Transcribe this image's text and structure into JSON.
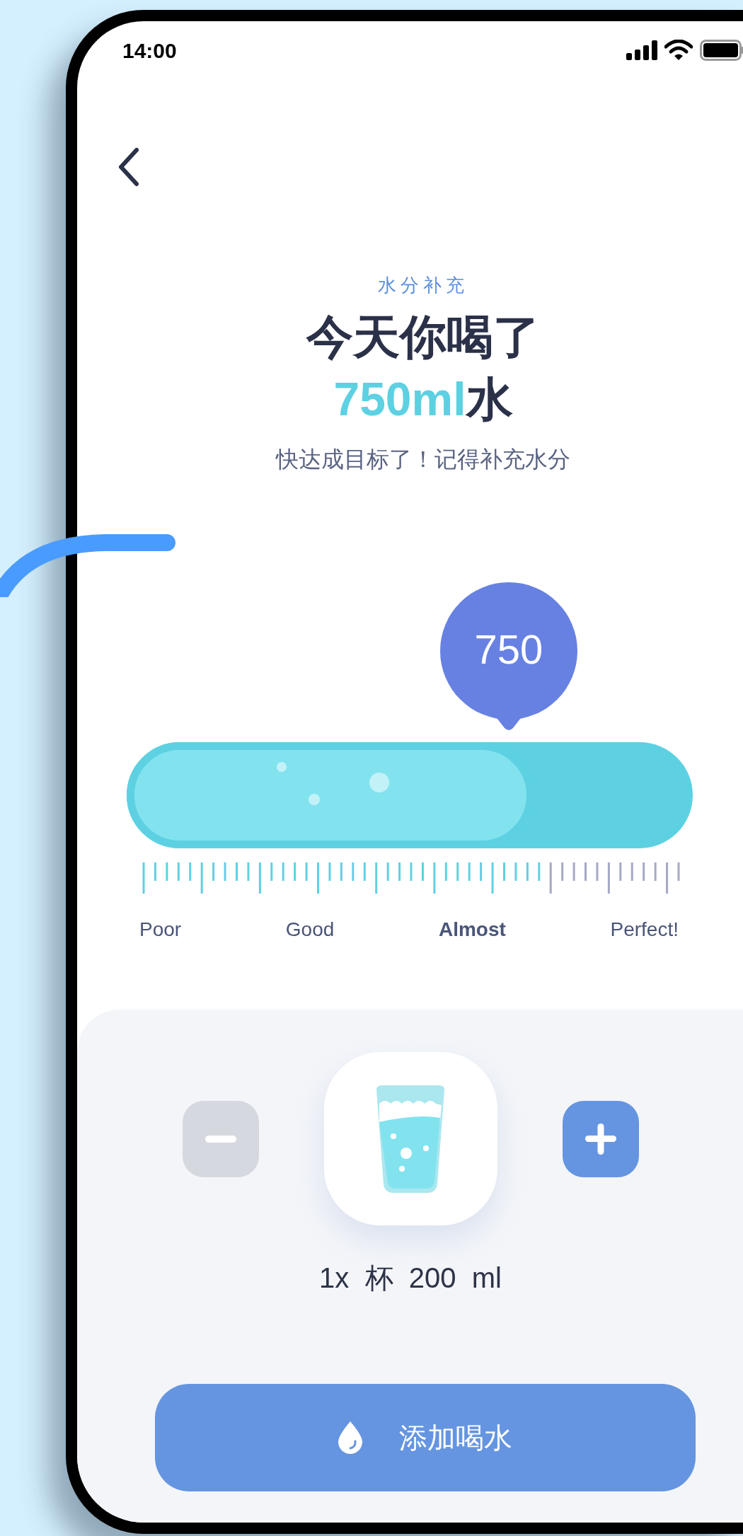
{
  "status_bar": {
    "time": "14:00"
  },
  "header": {
    "eyebrow": "水分补充",
    "title": "今天你喝了",
    "amount": "750ml",
    "amount_suffix": "水",
    "subtitle": "快达成目标了！记得补充水分"
  },
  "meter": {
    "bubble": "750",
    "level": 0.72,
    "labels": [
      {
        "text": "Poor",
        "selected": false
      },
      {
        "text": "Good",
        "selected": false
      },
      {
        "text": "Almost",
        "selected": true
      },
      {
        "text": "Perfect!",
        "selected": false
      }
    ]
  },
  "portion": {
    "text": "1x  杯  200  ml"
  },
  "add_button": {
    "label": "添加喝水"
  }
}
